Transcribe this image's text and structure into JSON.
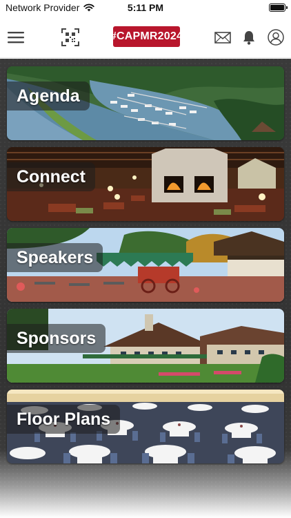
{
  "status_bar": {
    "carrier": "Network Provider",
    "time": "5:11 PM",
    "battery_level": 1.0
  },
  "header": {
    "menu_icon": "hamburger-menu-icon",
    "scan_icon": "qr-scan-icon",
    "hashtag": "#CAPMR2024",
    "mail_icon": "envelope-icon",
    "notifications_icon": "bell-icon",
    "profile_icon": "user-profile-icon",
    "brand_color": "#b8162c"
  },
  "tiles": [
    {
      "label": "Agenda"
    },
    {
      "label": "Connect"
    },
    {
      "label": "Speakers"
    },
    {
      "label": "Sponsors"
    },
    {
      "label": "Floor Plans"
    }
  ]
}
